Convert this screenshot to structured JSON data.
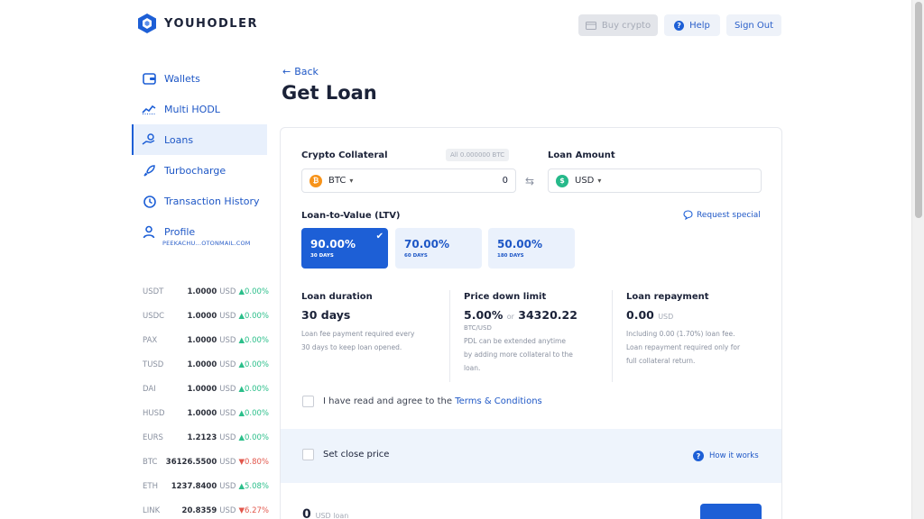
{
  "brand": {
    "name": "YOUHODLER",
    "accent": "#1d5fd6"
  },
  "header": {
    "buy_label": "Buy crypto",
    "help_label": "Help",
    "signout_label": "Sign Out"
  },
  "sidebar": {
    "items": [
      {
        "label": "Wallets",
        "icon": "wallet-icon"
      },
      {
        "label": "Multi HODL",
        "icon": "chart-line-icon"
      },
      {
        "label": "Loans",
        "icon": "loan-hand-icon",
        "active": true
      },
      {
        "label": "Turbocharge",
        "icon": "rocket-icon"
      },
      {
        "label": "Transaction History",
        "icon": "history-icon"
      },
      {
        "label": "Profile",
        "icon": "user-icon"
      }
    ],
    "profile_email": "PEEKACHU...OTONMAIL.COM"
  },
  "ticker": [
    {
      "symbol": "USDT",
      "value": "1.0000",
      "currency": "USD",
      "change": "0.00%",
      "dir": "up"
    },
    {
      "symbol": "USDC",
      "value": "1.0000",
      "currency": "USD",
      "change": "0.00%",
      "dir": "up"
    },
    {
      "symbol": "PAX",
      "value": "1.0000",
      "currency": "USD",
      "change": "0.00%",
      "dir": "up"
    },
    {
      "symbol": "TUSD",
      "value": "1.0000",
      "currency": "USD",
      "change": "0.00%",
      "dir": "up"
    },
    {
      "symbol": "DAI",
      "value": "1.0000",
      "currency": "USD",
      "change": "0.00%",
      "dir": "up"
    },
    {
      "symbol": "HUSD",
      "value": "1.0000",
      "currency": "USD",
      "change": "0.00%",
      "dir": "up"
    },
    {
      "symbol": "EURS",
      "value": "1.2123",
      "currency": "USD",
      "change": "0.00%",
      "dir": "up"
    },
    {
      "symbol": "BTC",
      "value": "36126.5500",
      "currency": "USD",
      "change": "0.80%",
      "dir": "down"
    },
    {
      "symbol": "ETH",
      "value": "1237.8400",
      "currency": "USD",
      "change": "5.08%",
      "dir": "up"
    },
    {
      "symbol": "LINK",
      "value": "20.8359",
      "currency": "USD",
      "change": "6.27%",
      "dir": "down"
    }
  ],
  "page": {
    "back_label": "Back",
    "title": "Get Loan"
  },
  "form": {
    "collateral_label": "Crypto Collateral",
    "collateral_all": "All 0.000000 BTC",
    "collateral_currency": "BTC",
    "collateral_value": "0",
    "loan_amount_label": "Loan Amount",
    "loan_currency": "USD",
    "ltv_label": "Loan-to-Value (LTV)",
    "request_special": "Request special",
    "ltv_options": [
      {
        "pct": "90.00%",
        "days": "30 DAYS",
        "selected": true
      },
      {
        "pct": "70.00%",
        "days": "60 DAYS",
        "selected": false
      },
      {
        "pct": "50.00%",
        "days": "180 DAYS",
        "selected": false
      }
    ],
    "duration": {
      "title": "Loan duration",
      "value": "30 days",
      "note_1": "Loan fee payment required every",
      "note_2": "30 days to keep loan opened."
    },
    "price_down": {
      "title": "Price down limit",
      "value_pct": "5.00%",
      "or": "or",
      "value_price": "34320.22",
      "pair": "BTC/USD",
      "note_1": "PDL can be extended anytime",
      "note_2": "by adding more collateral to the",
      "note_3": "loan."
    },
    "repayment": {
      "title": "Loan repayment",
      "value": "0.00",
      "unit": "USD",
      "note_1": "Including 0.00 (1.70%) loan fee.",
      "note_2": "Loan repayment required only for",
      "note_3": "full collateral return."
    },
    "agree_text": "I have read and agree to the",
    "terms_link": "Terms & Conditions",
    "close_price_label": "Set close price",
    "how_it_works": "How it works",
    "bottom_value": "0",
    "bottom_unit": "USD loan"
  }
}
